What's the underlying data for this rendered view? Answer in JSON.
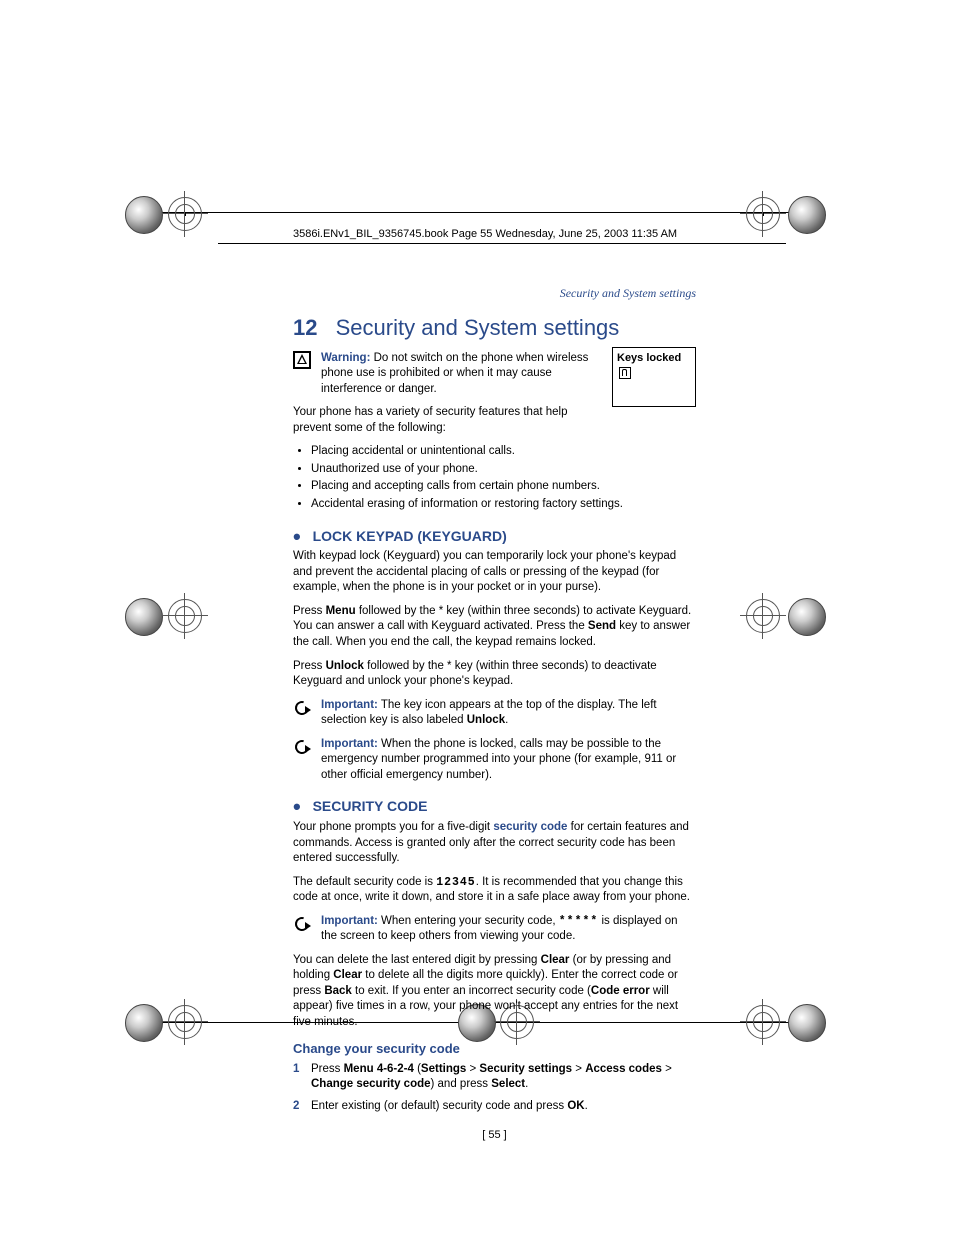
{
  "header": "3586i.ENv1_BIL_9356745.book  Page 55  Wednesday, June 25, 2003  11:35 AM",
  "running_head": "Security and System settings",
  "chapter": {
    "num": "12",
    "title": "Security and System settings"
  },
  "warning": {
    "label": "Warning:",
    "text": " Do not switch on the phone when wireless phone use is prohibited or when it may cause interference or danger."
  },
  "screen_label": "Keys locked",
  "intro": "Your phone has a variety of security features that help prevent some of the following:",
  "bullets": [
    "Placing accidental or unintentional calls.",
    "Unauthorized use of your phone.",
    "Placing and accepting calls from certain phone numbers.",
    "Accidental erasing of information or restoring factory settings."
  ],
  "sec1": {
    "title": "LOCK KEYPAD (KEYGUARD)",
    "p1": "With keypad lock (Keyguard) you can temporarily lock your phone's keypad and prevent the accidental placing of calls or pressing of the keypad (for example, when the phone is in your pocket or in your purse).",
    "p2a": "Press ",
    "p2b": "Menu",
    "p2c": " followed by the * key (within three seconds) to activate Keyguard. You can answer a call with Keyguard activated. Press the ",
    "p2d": "Send",
    "p2e": " key to answer the call. When you end the call, the keypad remains locked.",
    "p3a": "Press ",
    "p3b": "Unlock",
    "p3c": " followed by the * key (within three seconds) to deactivate Keyguard and unlock your phone's keypad.",
    "imp1": {
      "label": "Important:",
      "a": " The key icon appears at the top of the display. The left selection key is also labeled ",
      "b": "Unlock",
      "c": "."
    },
    "imp2": {
      "label": "Important:",
      "text": " When the phone is locked, calls may be possible to the emergency number programmed into your phone (for example, 911 or other official emergency number)."
    }
  },
  "sec2": {
    "title": "SECURITY CODE",
    "p1a": "Your phone prompts you for a five-digit ",
    "p1b": "security code",
    "p1c": " for certain features and commands. Access is granted only after the correct security code has been entered successfully.",
    "p2a": "The default security code is ",
    "p2b": "12345",
    "p2c": ". It is recommended that you change this code at once, write it down, and store it in a safe place away from your phone.",
    "imp": {
      "label": "Important:",
      "a": " When entering your security code, ",
      "b": "*****",
      "c": " is displayed on the screen to keep others from viewing your code."
    },
    "p3a": "You can delete the last entered digit by pressing ",
    "p3b": "Clear",
    "p3c": " (or by pressing and holding ",
    "p3d": "Clear",
    "p3e": " to delete all the digits more quickly). Enter the correct code or press ",
    "p3f": "Back",
    "p3g": " to exit. If you enter an incorrect security code (",
    "p3h": "Code error",
    "p3i": " will appear) five times in a row, your phone won't accept any entries for the next five minutes.",
    "h2": "Change your security code",
    "step1": {
      "a": "Press ",
      "b": "Menu 4-6-2-4",
      "c": " (",
      "d": "Settings",
      "e": " > ",
      "f": "Security settings",
      "g": " > ",
      "h": "Access codes",
      "i": " > ",
      "j": "Change security code",
      "k": ") and press ",
      "l": "Select",
      "m": "."
    },
    "step2": {
      "a": "Enter existing (or default) security code and press ",
      "b": "OK",
      "c": "."
    }
  },
  "page_number": "[ 55 ]"
}
